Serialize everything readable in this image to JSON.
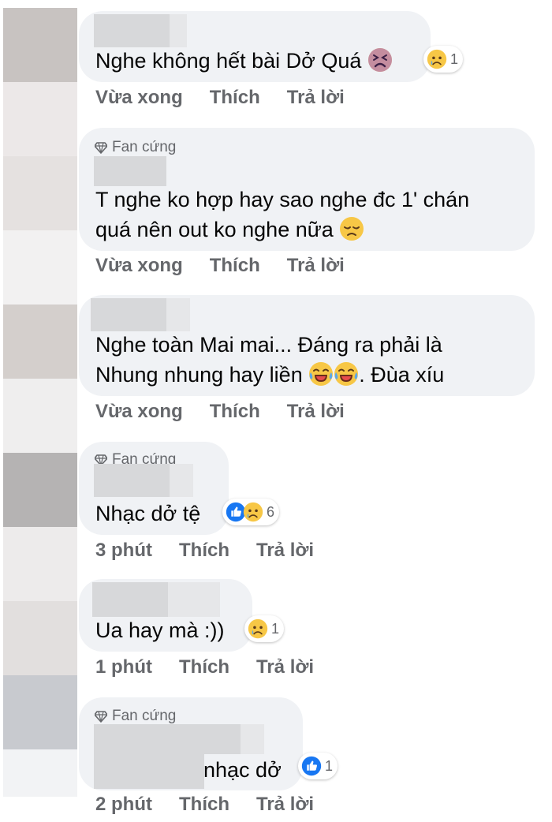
{
  "comments": [
    {
      "badge": "",
      "lines": [
        "Nghe không hết bài Dở Quá"
      ],
      "reaction_count": "1",
      "time": "Vừa xong",
      "like": "Thích",
      "reply": "Trả lời"
    },
    {
      "badge": "Fan cứng",
      "lines": [
        "T nghe ko hợp hay sao nghe đc 1' chán",
        "quá nên out ko nghe nữa"
      ],
      "time": "Vừa xong",
      "like": "Thích",
      "reply": "Trả lời"
    },
    {
      "badge": "",
      "lines": [
        "Nghe toàn Mai mai... Đáng ra phải là",
        "Nhung nhung hay liền",
        ". Đùa xíu"
      ],
      "time": "Vừa xong",
      "like": "Thích",
      "reply": "Trả lời"
    },
    {
      "badge": "Fan cứng",
      "lines": [
        "Nhạc dở tệ"
      ],
      "reaction_count": "6",
      "time": "3 phút",
      "like": "Thích",
      "reply": "Trả lời"
    },
    {
      "badge": "",
      "lines": [
        "Ua hay mà :))"
      ],
      "reaction_count": "1",
      "time": "1 phút",
      "like": "Thích",
      "reply": "Trả lời"
    },
    {
      "badge": "Fan cứng",
      "lines": [
        "nhạc dở"
      ],
      "reaction_count": "1",
      "time": "2 phút",
      "like": "Thích",
      "reply": "Trả lời"
    }
  ],
  "colors": {
    "bubble": "#f0f2f5",
    "meta": "#65676b",
    "like_blue": "#1877f2"
  },
  "icons": [
    "diamond-icon",
    "tired-face-emoji",
    "sad-face-emoji",
    "crying-face-emoji",
    "tears-of-joy-emoji",
    "like-icon"
  ]
}
